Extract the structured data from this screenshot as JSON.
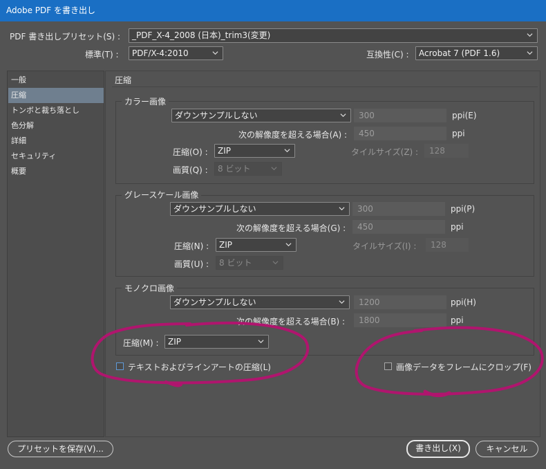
{
  "window": {
    "title": "Adobe PDF を書き出し"
  },
  "preset": {
    "label": "PDF 書き出しプリセット(S) :",
    "value": "_PDF_X-4_2008 (日本)_trim3(変更)"
  },
  "standard": {
    "label": "標準(T) :",
    "value": "PDF/X-4:2010"
  },
  "compat": {
    "label": "互換性(C) :",
    "value": "Acrobat 7 (PDF 1.6)"
  },
  "sidebar": {
    "items": [
      {
        "label": "一般"
      },
      {
        "label": "圧縮"
      },
      {
        "label": "トンボと裁ち落とし"
      },
      {
        "label": "色分解"
      },
      {
        "label": "詳細"
      },
      {
        "label": "セキュリティ"
      },
      {
        "label": "概要"
      }
    ]
  },
  "main": {
    "section_title": "圧縮"
  },
  "color": {
    "title": "カラー画像",
    "downsample": "ダウンサンプルしない",
    "ppi_value": "300",
    "ppi_label": "ppi(E)",
    "threshold_label": "次の解像度を超える場合(A) :",
    "threshold_value": "450",
    "threshold_unit": "ppi",
    "compression_label": "圧縮(O) :",
    "compression_value": "ZIP",
    "tile_label": "タイルサイズ(Z) :",
    "tile_value": "128",
    "quality_label": "画質(Q) :",
    "quality_value": "8 ビット"
  },
  "gray": {
    "title": "グレースケール画像",
    "downsample": "ダウンサンプルしない",
    "ppi_value": "300",
    "ppi_label": "ppi(P)",
    "threshold_label": "次の解像度を超える場合(G) :",
    "threshold_value": "450",
    "threshold_unit": "ppi",
    "compression_label": "圧縮(N) :",
    "compression_value": "ZIP",
    "tile_label": "タイルサイズ(I) :",
    "tile_value": "128",
    "quality_label": "画質(U) :",
    "quality_value": "8 ビット"
  },
  "mono": {
    "title": "モノクロ画像",
    "downsample": "ダウンサンプルしない",
    "ppi_value": "1200",
    "ppi_label": "ppi(H)",
    "threshold_label": "次の解像度を超える場合(B) :",
    "threshold_value": "1800",
    "threshold_unit": "ppi",
    "compression_label": "圧縮(M) :",
    "compression_value": "ZIP"
  },
  "options": {
    "compress_text_label": "テキストおよびラインアートの圧縮(L)",
    "crop_image_label": "画像データをフレームにクロップ(F)"
  },
  "footer": {
    "save_preset": "プリセットを保存(V)...",
    "export": "書き出し(X)",
    "cancel": "キャンセル"
  },
  "colors": {
    "title_bar": "#1a6fc4",
    "annotation": "#b0156e",
    "background": "#535353"
  }
}
